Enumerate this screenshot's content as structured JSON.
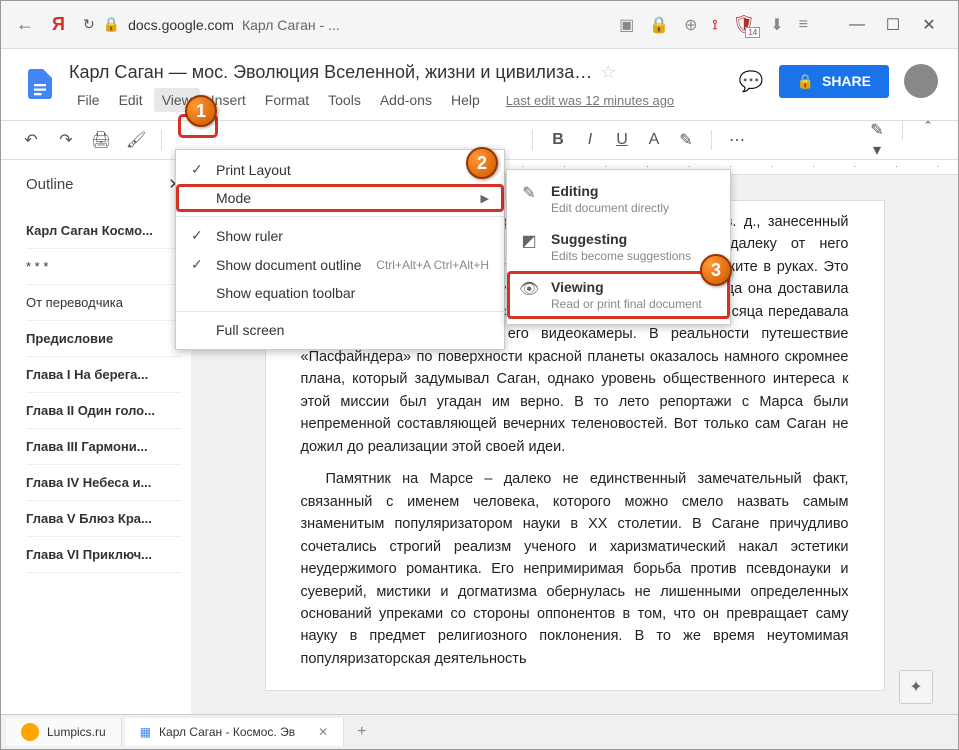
{
  "browser": {
    "domain": "docs.google.com",
    "tab_title": "Карл Саган - ...",
    "ext_badge": "14"
  },
  "header": {
    "doc_title": "Карл Саган — мос. Эволюция Вселенной, жизни и цивилиза…",
    "menus": [
      "File",
      "Edit",
      "View",
      "Insert",
      "Format",
      "Tools",
      "Add-ons",
      "Help"
    ],
    "last_edit": "Last edit was 12 minutes ago",
    "share": "SHARE"
  },
  "view_menu": {
    "print_layout": "Print Layout",
    "mode": "Mode",
    "show_ruler": "Show ruler",
    "show_outline": "Show document outline",
    "show_outline_shortcut": "Ctrl+Alt+A Ctrl+Alt+H",
    "equation_toolbar": "Show equation toolbar",
    "full_screen": "Full screen"
  },
  "mode_menu": {
    "editing": {
      "title": "Editing",
      "sub": "Edit document directly"
    },
    "suggesting": {
      "title": "Suggesting",
      "sub": "Edits become suggestions"
    },
    "viewing": {
      "title": "Viewing",
      "sub": "Read or print final document"
    }
  },
  "outline": {
    "header": "Outline",
    "items": [
      "Карл Саган Космо...",
      "* * *",
      "От переводчика",
      "Предисловие",
      "Глава I На берега...",
      "Глава II Один голо...",
      "Глава III Гармони...",
      "Глава IV Небеса и...",
      "Глава V Блюз Кра...",
      "Глава VI Приключ..."
    ]
  },
  "document": {
    "p1": "На Марсе, в точке с координатами 19°20′ с. ш., 33°33′ з. д., занесенный песком, стоит небольшой самоходный аппарат. А неподалеку от него установлен памятник человеку, книгу которого вы сейчас держите в руках. Это мемориальная станция имени Карла Сагана. В июле 1997 года она доставила сюда самоходный ровер «Пасфайндер», а потом почти три месяца передавала на Землю изображения с его видеокамеры. В реальности путешествие «Пасфайндера» по поверхности красной планеты оказалось намного скромнее плана, который задумывал Саган, однако уровень общественного интереса к этой миссии был угадан им верно. В то лето репортажи с Марса были непременной составляющей вечерних теленовостей. Вот только сам Саган не дожил до реализации этой своей идеи.",
    "p2": "Памятник на Марсе – далеко не единственный замечательный факт, связанный с именем человека, которого можно смело назвать самым знаменитым популяризатором науки в XX столетии. В Сагане причудливо сочетались строгий реализм ученого и харизматический накал эстетики неудержимого романтика. Его непримиримая борьба против псевдонауки и суеверий, мистики и догматизма обернулась не лишенными определенных оснований упреками со стороны оппонентов в том, что он превращает саму науку в предмет религиозного поклонения. В то же время неутомимая популяризаторская деятельность"
  },
  "taskbar": {
    "tab1": "Lumpics.ru",
    "tab2": "Карл Саган - Космос. Эв"
  },
  "badges": {
    "b1": "1",
    "b2": "2",
    "b3": "3"
  }
}
